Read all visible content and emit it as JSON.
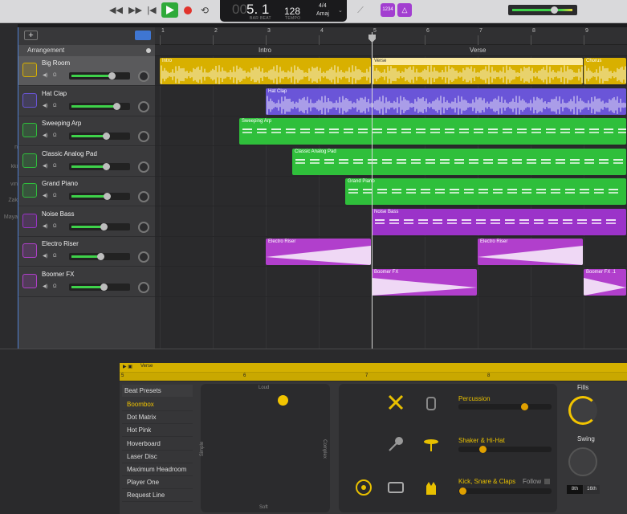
{
  "lcd": {
    "bar_beat": "5. 1",
    "bar_label": "BAR",
    "beat_label": "BEAT",
    "tempo": "128",
    "tempo_label": "TEMPO",
    "time_sig": "4/4",
    "key": "Amaj"
  },
  "toolbar": {
    "count_in_badge": "1234"
  },
  "left_strip": [
    "n",
    "kki",
    "vin",
    "Zak",
    "Maya"
  ],
  "arrangement": {
    "header_label": "Arrangement"
  },
  "ruler": [
    "1",
    "2",
    "3",
    "4",
    "5",
    "6",
    "7",
    "8",
    "9"
  ],
  "markers": {
    "intro": "Intro",
    "verse": "Verse"
  },
  "tracks": [
    {
      "name": "Big Room",
      "color": "#d8b000",
      "volume": 0.7
    },
    {
      "name": "Hat Clap",
      "color": "#6a55d8",
      "volume": 0.78
    },
    {
      "name": "Sweeping Arp",
      "color": "#2fbf3b",
      "volume": 0.6
    },
    {
      "name": "Classic Analog Pad",
      "color": "#2fbf3b",
      "volume": 0.6
    },
    {
      "name": "Grand Piano",
      "color": "#2fbf3b",
      "volume": 0.62
    },
    {
      "name": "Noise Bass",
      "color": "#9b33c9",
      "volume": 0.56
    },
    {
      "name": "Electro Riser",
      "color": "#b13fcc",
      "volume": 0.5
    },
    {
      "name": "Boomer FX",
      "color": "#b13fcc",
      "volume": 0.55
    }
  ],
  "regions": {
    "big_room_intro": "Intro",
    "big_room_verse": "Verse",
    "big_room_chorus": "Chorus",
    "hat_clap": "Hat Clap",
    "sweeping_arp": "Sweeping Arp",
    "classic_analog_pad": "Classic Analog Pad",
    "grand_piano": "Grand Piano",
    "noise_bass": "Noise Bass",
    "electro_riser_1": "Electro Riser",
    "electro_riser_2": "Electro Riser",
    "boomer_fx_1": "Boomer FX",
    "boomer_fx_2": "Boomer FX .1"
  },
  "editor": {
    "region_title": "Verse",
    "ruler": [
      "5",
      "6",
      "7",
      "8"
    ],
    "presets_header": "Beat Presets",
    "presets": [
      "Boombox",
      "Dot Matrix",
      "Hot Pink",
      "Hoverboard",
      "Laser Disc",
      "Maximum Headroom",
      "Player One",
      "Request Line"
    ],
    "xy": {
      "loud": "Loud",
      "soft": "Soft",
      "simple": "Simple",
      "complex": "Complex"
    },
    "lanes": {
      "percussion": "Percussion",
      "shaker": "Shaker & Hi-Hat",
      "kick": "Kick, Snare & Claps",
      "follow": "Follow"
    },
    "knobs": {
      "fills": "Fills",
      "swing": "Swing",
      "eighth": "8th",
      "sixteenth": "16th"
    }
  }
}
